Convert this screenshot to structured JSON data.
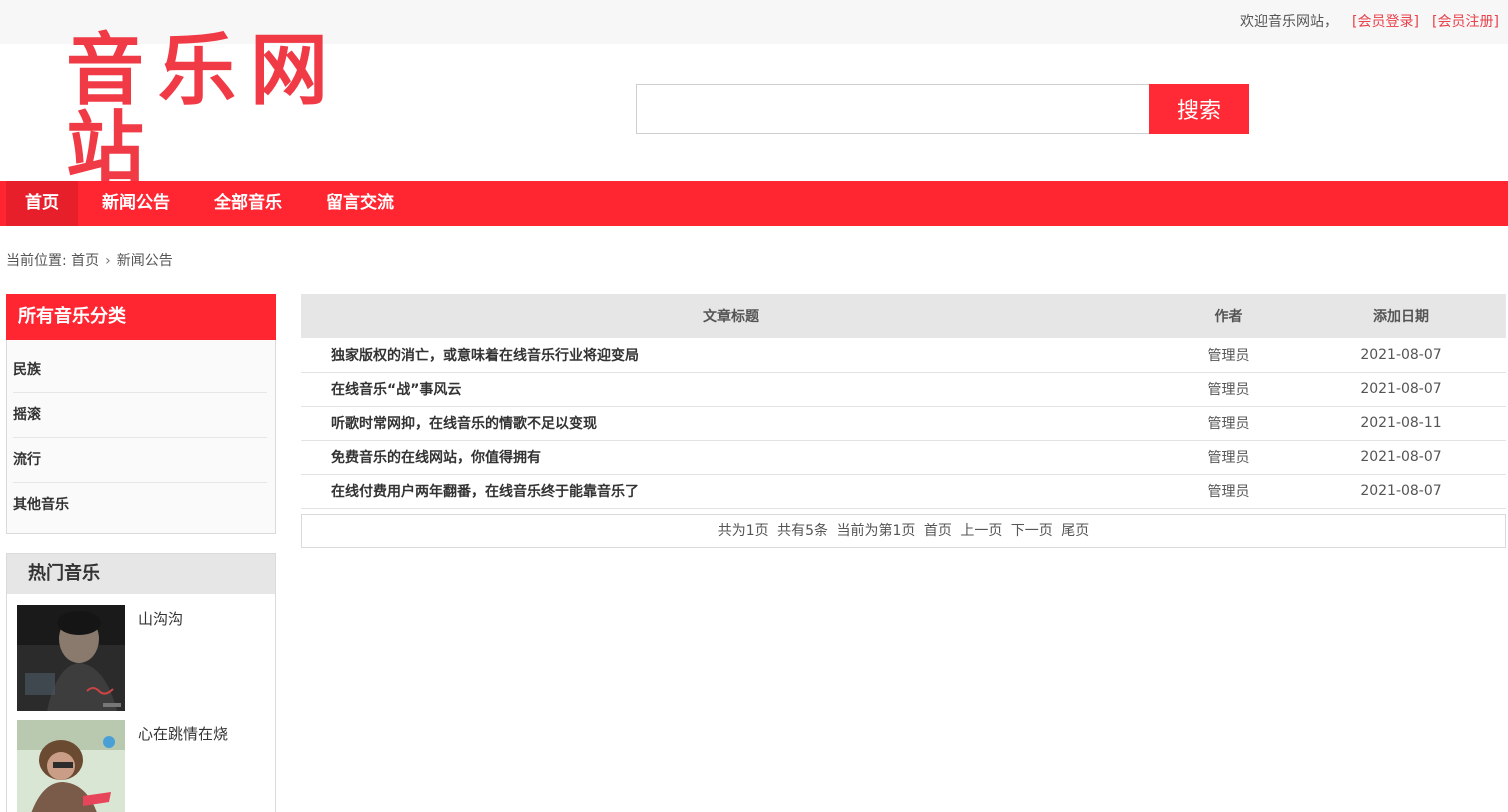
{
  "topbar": {
    "welcome": "欢迎音乐网站，",
    "login": "[会员登录]",
    "register": "[会员注册]"
  },
  "logo": {
    "text": "音乐网站"
  },
  "search": {
    "value": "",
    "placeholder": "",
    "button": "搜索"
  },
  "nav": {
    "items": [
      {
        "label": "首页"
      },
      {
        "label": "新闻公告"
      },
      {
        "label": "全部音乐"
      },
      {
        "label": "留言交流"
      }
    ]
  },
  "breadcrumb": {
    "prefix": "当前位置:",
    "home": "首页",
    "separator": "›",
    "current": "新闻公告"
  },
  "categories": {
    "title": "所有音乐分类",
    "items": [
      "民族",
      "摇滚",
      "流行",
      "其他音乐"
    ]
  },
  "hot": {
    "title": "热门音乐",
    "items": [
      {
        "title": "山沟沟"
      },
      {
        "title": "心在跳情在烧"
      }
    ]
  },
  "table": {
    "headers": [
      "文章标题",
      "作者",
      "添加日期"
    ],
    "rows": [
      {
        "title": "独家版权的消亡，或意味着在线音乐行业将迎变局",
        "author": "管理员",
        "date": "2021-08-07"
      },
      {
        "title": "在线音乐“战”事风云",
        "author": "管理员",
        "date": "2021-08-07"
      },
      {
        "title": "听歌时常网抑，在线音乐的情歌不足以变现",
        "author": "管理员",
        "date": "2021-08-11"
      },
      {
        "title": "免费音乐的在线网站，你值得拥有",
        "author": "管理员",
        "date": "2021-08-07"
      },
      {
        "title": "在线付费用户两年翻番，在线音乐终于能靠音乐了",
        "author": "管理员",
        "date": "2021-08-07"
      }
    ]
  },
  "pager": {
    "total_pages": "共为1页",
    "total_items": "共有5条",
    "current": "当前为第1页",
    "first": "首页",
    "prev": "上一页",
    "next": "下一页",
    "last": "尾页"
  },
  "colors": {
    "accent": "#ff2632",
    "accent_dark": "#e71f2a",
    "link": "#e8414b"
  }
}
